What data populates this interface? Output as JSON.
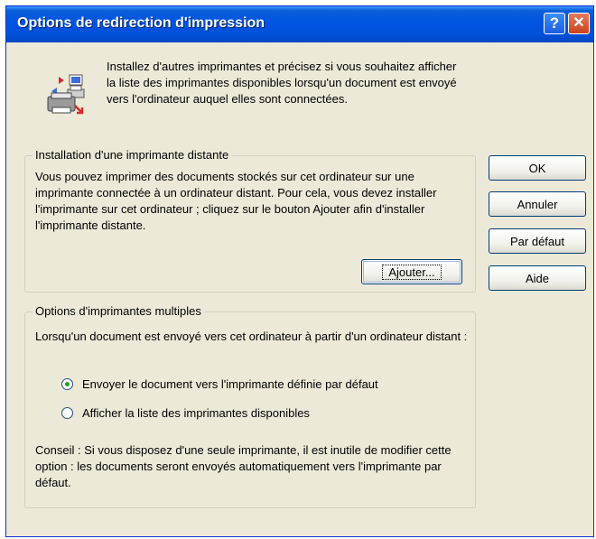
{
  "window": {
    "title": "Options de redirection d'impression",
    "help_glyph": "?",
    "close_glyph": "✕"
  },
  "intro": {
    "text": "Installez d'autres imprimantes et précisez si vous souhaitez afficher la liste des imprimantes disponibles lorsqu'un document est envoyé vers l'ordinateur auquel elles sont connectées.",
    "icon": "printer-network-icon"
  },
  "remote_printer_group": {
    "legend": "Installation d'une imprimante distante",
    "description": "Vous pouvez imprimer des documents stockés sur cet ordinateur sur une imprimante connectée à un ordinateur distant. Pour cela, vous devez installer l'imprimante sur cet ordinateur ; cliquez sur le bouton Ajouter afin d'installer l'imprimante distante.",
    "add_button": "Ajouter..."
  },
  "multi_printer_group": {
    "legend": "Options d'imprimantes multiples",
    "description": "Lorsqu'un document est envoyé vers cet ordinateur à partir d'un ordinateur distant :",
    "options": [
      {
        "label": "Envoyer le document vers l'imprimante définie par défaut",
        "checked": true
      },
      {
        "label": "Afficher la liste des imprimantes disponibles",
        "checked": false
      }
    ],
    "tip": "Conseil : Si vous disposez d'une seule imprimante, il est inutile de modifier cette option : les documents seront envoyés automatiquement vers l'imprimante par défaut."
  },
  "buttons": {
    "ok": "OK",
    "cancel": "Annuler",
    "default": "Par défaut",
    "help": "Aide"
  },
  "colors": {
    "titlebar": "#0054e3",
    "dialog_bg": "#ece9d8",
    "close_button": "#c8441c"
  }
}
